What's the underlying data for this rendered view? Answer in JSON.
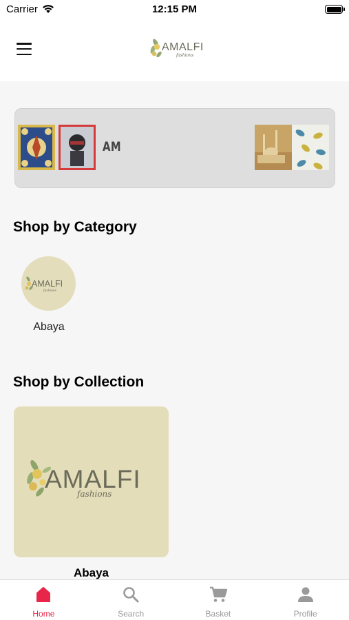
{
  "status_bar": {
    "carrier": "Carrier",
    "time": "12:15 PM"
  },
  "header": {
    "logo_text": "AMALFI",
    "logo_subtext": "fashions"
  },
  "banner": {
    "text": "AM"
  },
  "categories": {
    "title": "Shop by Category",
    "items": [
      {
        "label": "Abaya",
        "logo_text": "AMALFI",
        "logo_subtext": "fashions"
      }
    ]
  },
  "collections": {
    "title": "Shop by Collection",
    "items": [
      {
        "label": "Abaya",
        "logo_text": "AMALFI",
        "logo_subtext": "fashions"
      }
    ]
  },
  "tab_bar": {
    "tabs": [
      {
        "label": "Home",
        "icon": "home-icon",
        "active": true
      },
      {
        "label": "Search",
        "icon": "search-icon",
        "active": false
      },
      {
        "label": "Basket",
        "icon": "cart-icon",
        "active": false
      },
      {
        "label": "Profile",
        "icon": "profile-icon",
        "active": false
      }
    ]
  },
  "colors": {
    "accent": "#e8264a",
    "tab_inactive": "#9a9a9a",
    "brand_beige": "#e4ddb9"
  }
}
